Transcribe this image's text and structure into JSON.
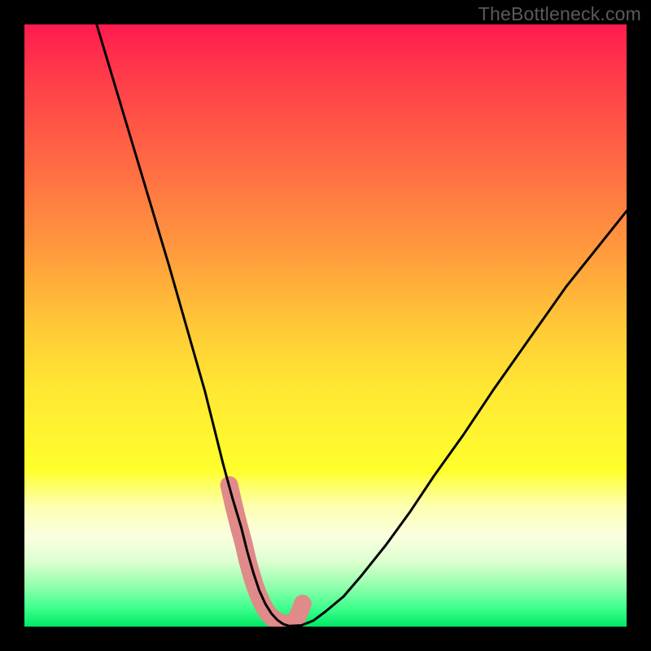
{
  "watermark": "TheBottleneck.com",
  "chart_data": {
    "type": "line",
    "title": "",
    "xlabel": "",
    "ylabel": "",
    "xlim": [
      0,
      100
    ],
    "ylim": [
      0,
      100
    ],
    "series": [
      {
        "name": "curve",
        "x": [
          12,
          15,
          18,
          21,
          24,
          26,
          28,
          30,
          31.5,
          33,
          34.5,
          36,
          37,
          38,
          39,
          40,
          41,
          42,
          43,
          44,
          46,
          48,
          50,
          53,
          56,
          60,
          64,
          68,
          73,
          78,
          84,
          90,
          96,
          100
        ],
        "values": [
          100,
          90,
          80,
          70,
          60,
          53,
          46,
          39,
          33,
          27,
          21.5,
          16.5,
          12.5,
          9,
          6,
          3.8,
          2.2,
          1.1,
          0.4,
          0.1,
          0.2,
          1,
          2.5,
          5,
          8.5,
          13.5,
          19,
          25,
          32,
          39.5,
          48,
          56.5,
          64,
          69
        ]
      }
    ],
    "highlight_band": {
      "name": "bottleneck-zone",
      "x": [
        34.0,
        34.8,
        35.6,
        36.4,
        37.0,
        37.6,
        38.2,
        38.8,
        39.4,
        40.0,
        40.6,
        41.4,
        42.2,
        43.0,
        43.8,
        44.6,
        45.2,
        45.7,
        46.2
      ],
      "values": [
        23.5,
        20.0,
        16.8,
        13.8,
        11.2,
        9.0,
        7.0,
        5.4,
        4.0,
        2.9,
        2.0,
        1.3,
        0.8,
        0.5,
        0.5,
        0.8,
        1.4,
        2.4,
        3.8
      ]
    },
    "colors": {
      "curve": "#000000",
      "highlight": "#e08a8a",
      "gradient_top": "#ff1a4f",
      "gradient_mid": "#ffff2c",
      "gradient_bottom": "#00e864"
    }
  }
}
